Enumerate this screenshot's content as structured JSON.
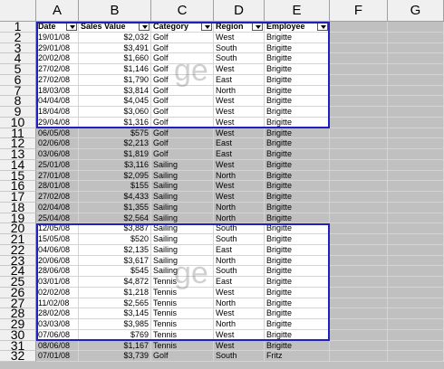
{
  "columns": [
    "A",
    "B",
    "C",
    "D",
    "E",
    "F",
    "G"
  ],
  "header_row": [
    "Date",
    "Sales Value",
    "Category",
    "Region",
    "Employee"
  ],
  "rows": [
    [
      "19/01/08",
      "$2,032",
      "Golf",
      "West",
      "Brigitte"
    ],
    [
      "29/01/08",
      "$3,491",
      "Golf",
      "South",
      "Brigitte"
    ],
    [
      "20/02/08",
      "$1,660",
      "Golf",
      "South",
      "Brigitte"
    ],
    [
      "27/02/08",
      "$1,146",
      "Golf",
      "West",
      "Brigitte"
    ],
    [
      "27/02/08",
      "$1,790",
      "Golf",
      "East",
      "Brigitte"
    ],
    [
      "18/03/08",
      "$3,814",
      "Golf",
      "North",
      "Brigitte"
    ],
    [
      "04/04/08",
      "$4,045",
      "Golf",
      "West",
      "Brigitte"
    ],
    [
      "18/04/08",
      "$3,060",
      "Golf",
      "West",
      "Brigitte"
    ],
    [
      "29/04/08",
      "$1,316",
      "Golf",
      "West",
      "Brigitte"
    ],
    [
      "06/05/08",
      "$575",
      "Golf",
      "West",
      "Brigitte"
    ],
    [
      "02/06/08",
      "$2,213",
      "Golf",
      "East",
      "Brigitte"
    ],
    [
      "03/06/08",
      "$1,819",
      "Golf",
      "East",
      "Brigitte"
    ],
    [
      "25/01/08",
      "$3,116",
      "Sailing",
      "West",
      "Brigitte"
    ],
    [
      "27/01/08",
      "$2,095",
      "Sailing",
      "North",
      "Brigitte"
    ],
    [
      "28/01/08",
      "$155",
      "Sailing",
      "West",
      "Brigitte"
    ],
    [
      "27/02/08",
      "$4,433",
      "Sailing",
      "West",
      "Brigitte"
    ],
    [
      "02/04/08",
      "$1,355",
      "Sailing",
      "North",
      "Brigitte"
    ],
    [
      "25/04/08",
      "$2,564",
      "Sailing",
      "North",
      "Brigitte"
    ],
    [
      "12/05/08",
      "$3,887",
      "Sailing",
      "South",
      "Brigitte"
    ],
    [
      "15/05/08",
      "$520",
      "Sailing",
      "South",
      "Brigitte"
    ],
    [
      "04/06/08",
      "$2,135",
      "Sailing",
      "East",
      "Brigitte"
    ],
    [
      "20/06/08",
      "$3,617",
      "Sailing",
      "North",
      "Brigitte"
    ],
    [
      "28/06/08",
      "$545",
      "Sailing",
      "South",
      "Brigitte"
    ],
    [
      "03/01/08",
      "$4,872",
      "Tennis",
      "East",
      "Brigitte"
    ],
    [
      "02/02/08",
      "$1,218",
      "Tennis",
      "West",
      "Brigitte"
    ],
    [
      "11/02/08",
      "$2,565",
      "Tennis",
      "North",
      "Brigitte"
    ],
    [
      "28/02/08",
      "$3,145",
      "Tennis",
      "West",
      "Brigitte"
    ],
    [
      "03/03/08",
      "$3,985",
      "Tennis",
      "North",
      "Brigitte"
    ],
    [
      "07/06/08",
      "$769",
      "Tennis",
      "West",
      "Brigitte"
    ],
    [
      "08/06/08",
      "$1,167",
      "Tennis",
      "West",
      "Brigitte"
    ],
    [
      "07/01/08",
      "$3,739",
      "Golf",
      "South",
      "Fritz"
    ]
  ],
  "watermarks": [
    "ge",
    "ge"
  ],
  "colors": {
    "page_border": "#2020c0",
    "print_area": "#ffffff",
    "outside": "#c0c0c0"
  }
}
